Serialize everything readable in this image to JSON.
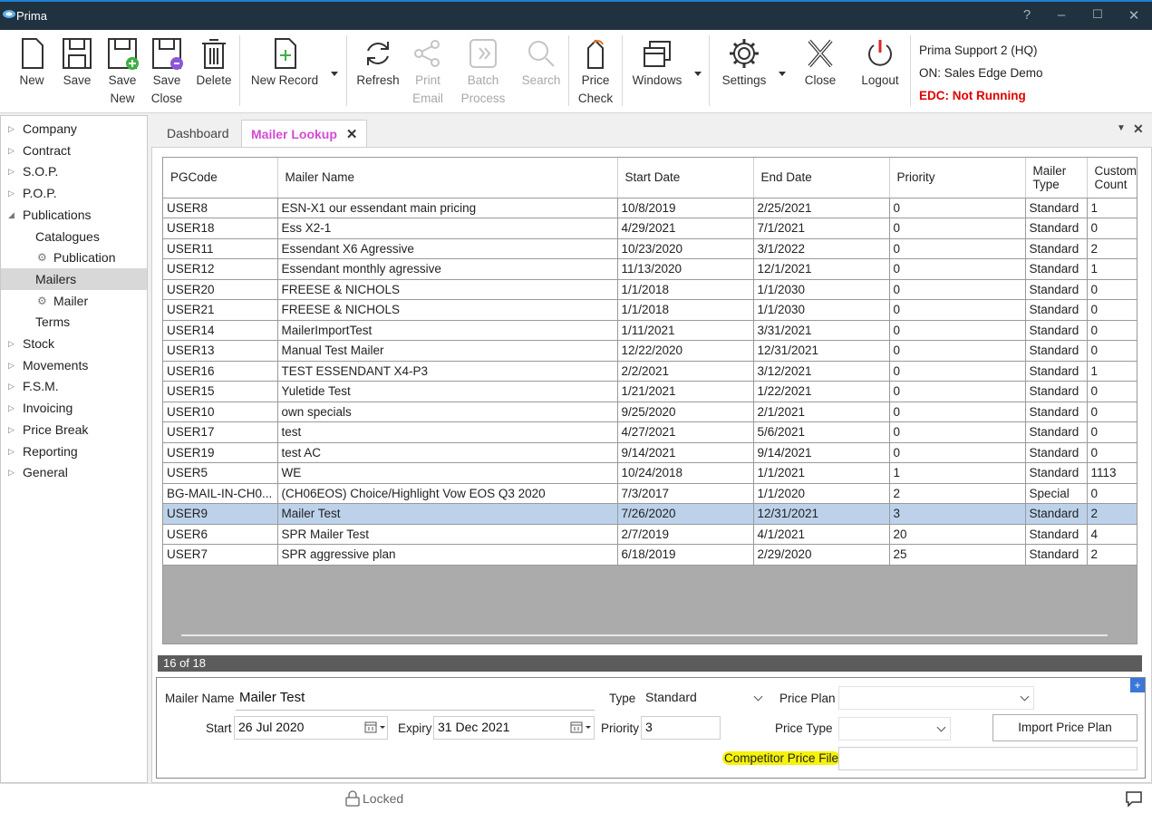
{
  "window": {
    "title": "Prima"
  },
  "toolbar": {
    "new": "New",
    "save": "Save",
    "save_new": "Save\nNew",
    "save_close": "Save\nClose",
    "delete": "Delete",
    "new_record": "New Record",
    "refresh": "Refresh",
    "print_email": "Print\nEmail",
    "batch_process": "Batch\nProcess",
    "search": "Search",
    "price_check": "Price\nCheck",
    "windows": "Windows",
    "settings": "Settings",
    "close": "Close",
    "logout": "Logout"
  },
  "user": {
    "name": "Prima Support 2 (HQ)",
    "connection": "ON: Sales Edge Demo",
    "edc_status": "EDC: Not Running"
  },
  "sidebar": {
    "items": [
      {
        "label": "Company",
        "expander": "▷"
      },
      {
        "label": "Contract",
        "expander": "▷"
      },
      {
        "label": "S.O.P.",
        "expander": "▷"
      },
      {
        "label": "P.O.P.",
        "expander": "▷"
      },
      {
        "label": "Publications",
        "expander": "◢"
      },
      {
        "label": "Catalogues",
        "expander": ""
      },
      {
        "label": "Publication",
        "expander": ""
      },
      {
        "label": "Mailers",
        "expander": ""
      },
      {
        "label": "Mailer",
        "expander": ""
      },
      {
        "label": "Terms",
        "expander": ""
      },
      {
        "label": "Stock",
        "expander": "▷"
      },
      {
        "label": "Movements",
        "expander": "▷"
      },
      {
        "label": "F.S.M.",
        "expander": "▷"
      },
      {
        "label": "Invoicing",
        "expander": "▷"
      },
      {
        "label": "Price Break",
        "expander": "▷"
      },
      {
        "label": "Reporting",
        "expander": "▷"
      },
      {
        "label": "General",
        "expander": "▷"
      }
    ]
  },
  "tabs": {
    "dashboard": "Dashboard",
    "mailer_lookup": "Mailer Lookup"
  },
  "grid": {
    "columns": [
      "PGCode",
      "Mailer Name",
      "Start Date",
      "End Date",
      "Priority",
      "Mailer Type",
      "Customer Count"
    ],
    "rows": [
      [
        "USER8",
        "ESN-X1 our essendant main pricing",
        "10/8/2019",
        "2/25/2021",
        "0",
        "Standard",
        "1"
      ],
      [
        "USER18",
        "Ess X2-1",
        "4/29/2021",
        "7/1/2021",
        "0",
        "Standard",
        "0"
      ],
      [
        "USER11",
        "Essendant X6 Agressive",
        "10/23/2020",
        "3/1/2022",
        "0",
        "Standard",
        "2"
      ],
      [
        "USER12",
        "Essendant monthly agressive",
        "11/13/2020",
        "12/1/2021",
        "0",
        "Standard",
        "1"
      ],
      [
        "USER20",
        "FREESE & NICHOLS",
        "1/1/2018",
        "1/1/2030",
        "0",
        "Standard",
        "0"
      ],
      [
        "USER21",
        "FREESE & NICHOLS",
        "1/1/2018",
        "1/1/2030",
        "0",
        "Standard",
        "0"
      ],
      [
        "USER14",
        "MailerImportTest",
        "1/11/2021",
        "3/31/2021",
        "0",
        "Standard",
        "0"
      ],
      [
        "USER13",
        "Manual Test Mailer",
        "12/22/2020",
        "12/31/2021",
        "0",
        "Standard",
        "0"
      ],
      [
        "USER16",
        "TEST ESSENDANT X4-P3",
        "2/2/2021",
        "3/12/2021",
        "0",
        "Standard",
        "1"
      ],
      [
        "USER15",
        "Yuletide Test",
        "1/21/2021",
        "1/22/2021",
        "0",
        "Standard",
        "0"
      ],
      [
        "USER10",
        "own specials",
        "9/25/2020",
        "2/1/2021",
        "0",
        "Standard",
        "0"
      ],
      [
        "USER17",
        "test",
        "4/27/2021",
        "5/6/2021",
        "0",
        "Standard",
        "0"
      ],
      [
        "USER19",
        "test AC",
        "9/14/2021",
        "9/14/2021",
        "0",
        "Standard",
        "0"
      ],
      [
        "USER5",
        "WE",
        "10/24/2018",
        "1/1/2021",
        "1",
        "Standard",
        "1113"
      ],
      [
        "BG-MAIL-IN-CH0...",
        "(CH06EOS) Choice/Highlight Vow EOS Q3 2020",
        "7/3/2017",
        "1/1/2020",
        "2",
        "Special",
        "0"
      ],
      [
        "USER9",
        "Mailer Test",
        "7/26/2020",
        "12/31/2021",
        "3",
        "Standard",
        "2"
      ],
      [
        "USER6",
        "SPR Mailer Test",
        "2/7/2019",
        "4/1/2021",
        "20",
        "Standard",
        "4"
      ],
      [
        "USER7",
        "SPR aggressive plan",
        "6/18/2019",
        "2/29/2020",
        "25",
        "Standard",
        "2"
      ]
    ],
    "selected_row": 15,
    "record_count": "16 of 18"
  },
  "detail": {
    "mailer_name_label": "Mailer Name",
    "mailer_name_value": "Mailer Test",
    "type_label": "Type",
    "type_value": "Standard",
    "price_plan_label": "Price Plan",
    "price_plan_value": "",
    "start_label": "Start",
    "start_value": "26 Jul 2020",
    "expiry_label": "Expiry",
    "expiry_value": "31 Dec 2021",
    "priority_label": "Priority",
    "priority_value": "3",
    "price_type_label": "Price Type",
    "price_type_value": "",
    "import_button": "Import Price Plan",
    "competitor_label": "Competitor Price File",
    "competitor_value": ""
  },
  "footer": {
    "locked_label": "Locked"
  },
  "colors": {
    "accent_tab": "#d34bd6",
    "edc_status": "#e00000",
    "selected_row": "#bdd2ea",
    "highlight": "#f6f20a"
  }
}
